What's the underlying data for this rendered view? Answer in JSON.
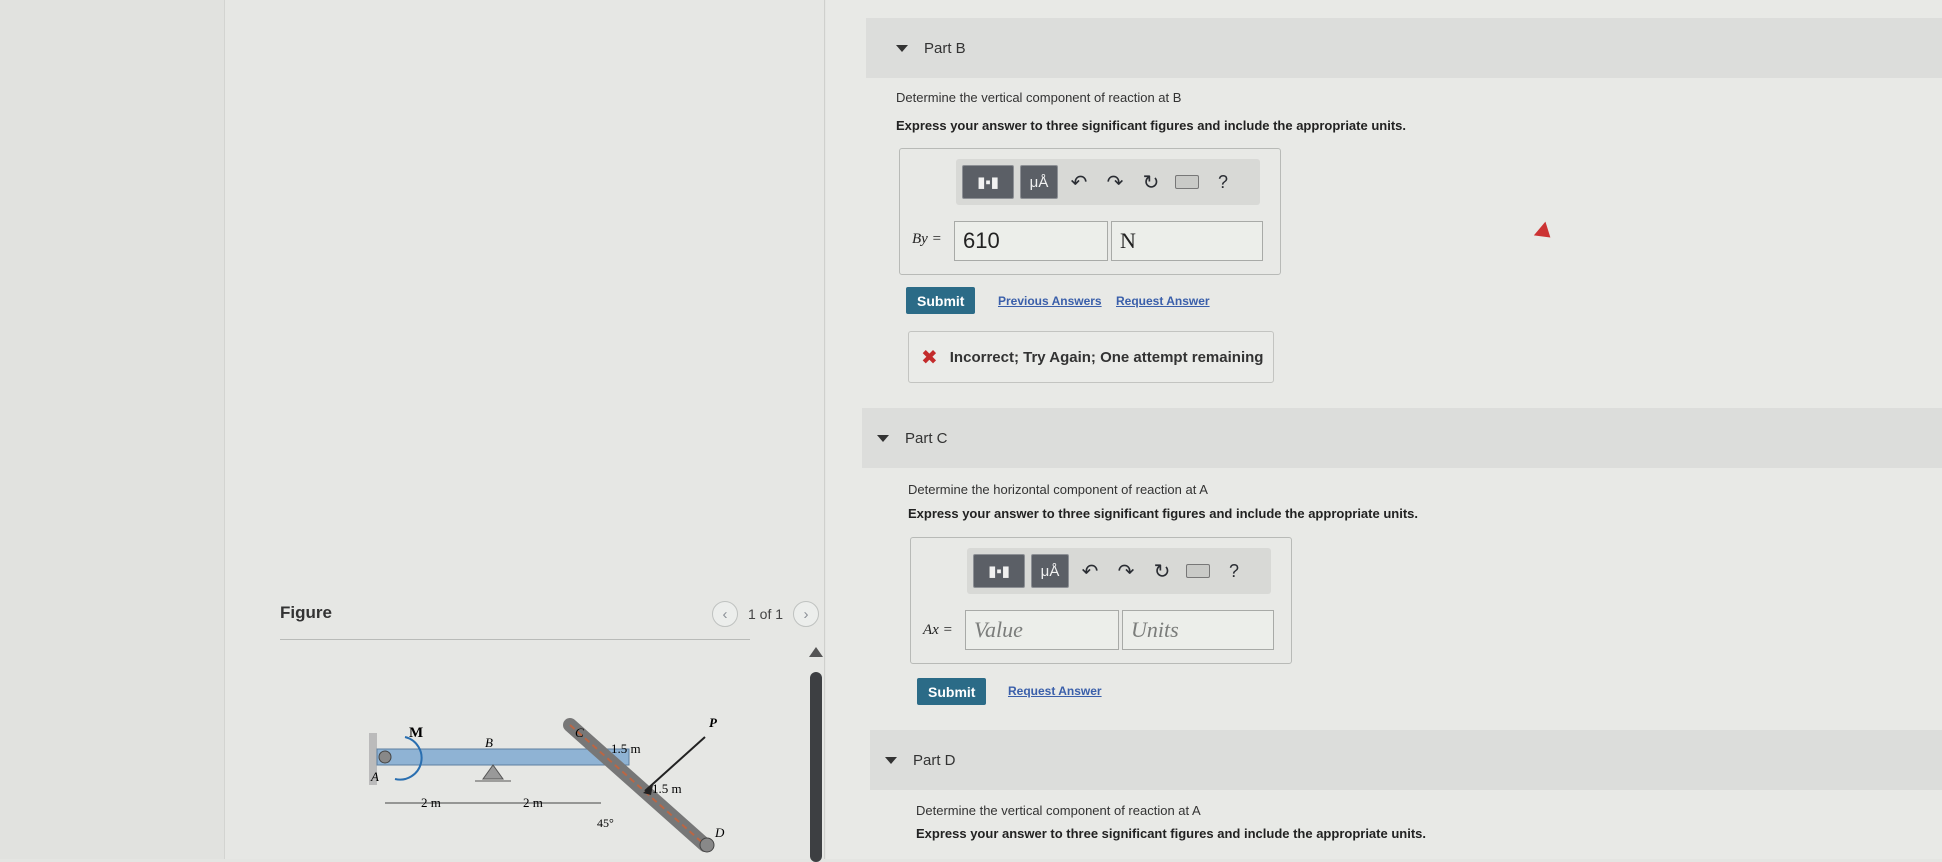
{
  "figure": {
    "label": "Figure",
    "pager_text": "1 of 1",
    "diagram": {
      "labels": {
        "moment": "M",
        "support_a": "A",
        "support_b": "B",
        "point_c": "C",
        "point_d": "D",
        "load_p": "P",
        "dim_ab": "2 m",
        "dim_bc": "2 m",
        "dim_cp": "1.5 m",
        "dim_pd": "1.5 m",
        "angle": "45°"
      }
    }
  },
  "partB": {
    "title": "Part B",
    "question": "Determine the vertical component of reaction at B",
    "instruction": "Express your answer to three significant figures and include the appropriate units.",
    "toolbar": {
      "units_btn": "μÅ",
      "help": "?"
    },
    "var_label": "By =",
    "value": "610",
    "units": "N",
    "submit": "Submit",
    "links": [
      "Previous Answers",
      "Request Answer"
    ],
    "feedback": "Incorrect; Try Again; One attempt remaining"
  },
  "partC": {
    "title": "Part C",
    "question": "Determine the horizontal component of reaction at A",
    "instruction": "Express your answer to three significant figures and include the appropriate units.",
    "toolbar": {
      "units_btn": "μÅ",
      "help": "?"
    },
    "var_label": "Ax =",
    "value_placeholder": "Value",
    "units_placeholder": "Units",
    "submit": "Submit",
    "links": [
      "Request Answer"
    ]
  },
  "partD": {
    "title": "Part D",
    "question": "Determine the vertical component of reaction at A",
    "instruction": "Express your answer to three significant figures and include the appropriate units."
  }
}
